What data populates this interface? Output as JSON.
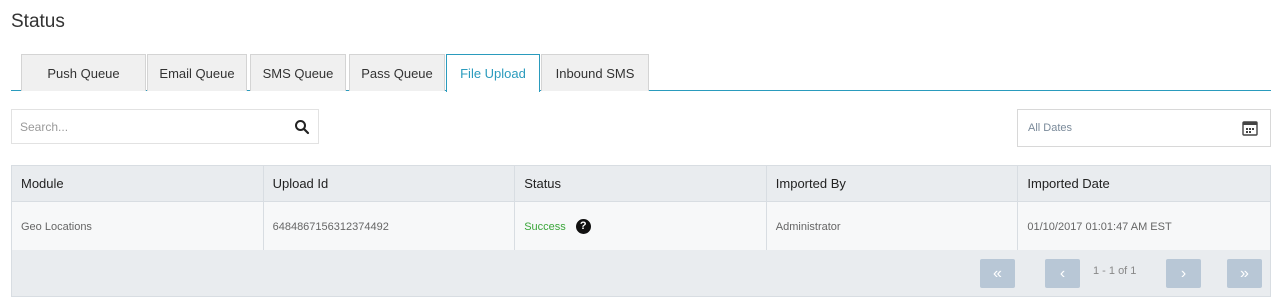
{
  "page": {
    "title": "Status"
  },
  "tabs": [
    {
      "label": "Push Queue"
    },
    {
      "label": "Email Queue"
    },
    {
      "label": "SMS Queue"
    },
    {
      "label": "Pass Queue"
    },
    {
      "label": "File Upload",
      "active": true
    },
    {
      "label": "Inbound SMS"
    }
  ],
  "search": {
    "placeholder": "Search..."
  },
  "date_filter": {
    "label": "All Dates"
  },
  "table": {
    "headers": [
      "Module",
      "Upload Id",
      "Status",
      "Imported By",
      "Imported Date"
    ],
    "rows": [
      [
        "Geo Locations",
        "6484867156312374492",
        "Success",
        "Administrator",
        "01/10/2017 01:01:47 AM EST"
      ]
    ]
  },
  "pagination": {
    "info": "1 - 1 of 1",
    "first_icon": "«",
    "prev_icon": "‹",
    "next_icon": "›",
    "last_icon": "»"
  },
  "colors": {
    "accent": "#2a9bbd",
    "success": "#3aa63a",
    "pager_button": "#b8c7d6"
  }
}
